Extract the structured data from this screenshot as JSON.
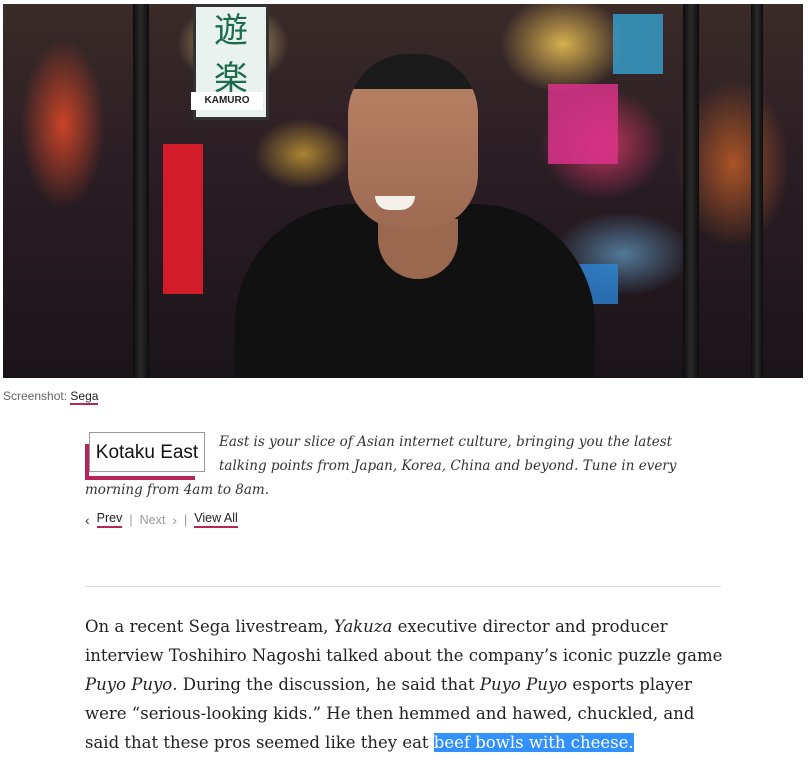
{
  "hero": {
    "signs": [
      "遊",
      "楽",
      "KAMURO"
    ]
  },
  "caption": {
    "prefix": "Screenshot:",
    "source": "Sega"
  },
  "series": {
    "badge": "Kotaku East",
    "description": "East is your slice of Asian internet culture, bringing you the latest talking points from Japan, Korea, China and beyond. Tune in every morning from 4am to 8am."
  },
  "nav": {
    "prev": "Prev",
    "next": "Next",
    "view_all": "View All",
    "separator": "|"
  },
  "article": {
    "p1_a": "On a recent Sega livestream, ",
    "p1_b": "Yakuza",
    "p1_c": " executive director and producer interview Toshihiro Nagoshi talked about the company’s iconic puzzle game ",
    "p1_d": "Puyo Puyo",
    "p1_e": ". During the discussion, he said that ",
    "p1_f": "Puyo Puyo",
    "p1_g": " esports player were “serious-looking kids.” He then hemmed and hawed, chuckled, and said that these pros seemed like they eat ",
    "p1_selected": "beef bowls with cheese."
  },
  "colors": {
    "accent": "#b8235a",
    "selection": "#3390ff"
  }
}
